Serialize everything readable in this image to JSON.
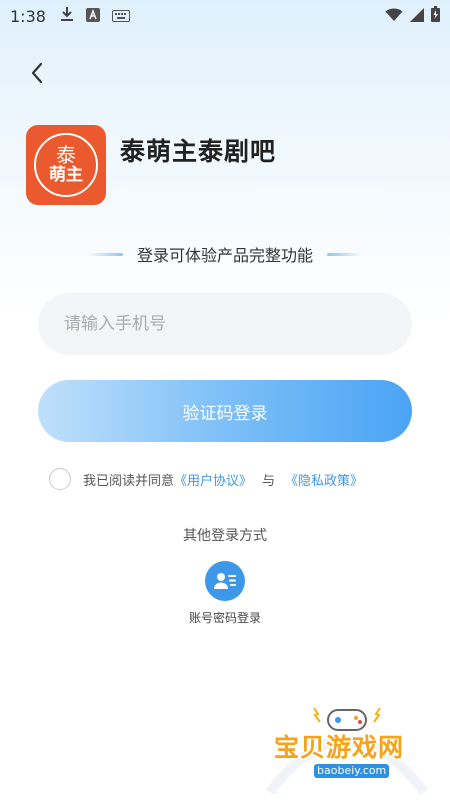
{
  "status_bar": {
    "time": "1:38",
    "left_icons": [
      "download-icon",
      "a-app-icon",
      "keyboard-icon"
    ],
    "right_icons": [
      "wifi-icon",
      "signal-icon",
      "battery-icon"
    ]
  },
  "nav": {
    "back_icon": "chevron-left-icon"
  },
  "app": {
    "logo_line1": "泰",
    "logo_line2": "萌主",
    "name": "泰萌主泰剧吧",
    "logo_color": "#ea5a2e"
  },
  "subtitle": "登录可体验产品完整功能",
  "phone_input": {
    "placeholder": "请输入手机号",
    "value": ""
  },
  "login_button": {
    "label": "验证码登录",
    "accent": "#4aa4f4"
  },
  "agreement": {
    "prefix": "我已阅读并同意",
    "user_agreement": "《用户协议》",
    "and": "与",
    "privacy_policy": "《隐私政策》",
    "link_color": "#3d98ea"
  },
  "other_login": {
    "title": "其他登录方式",
    "account_password_label": "账号密码登录",
    "icon": "user-card-icon"
  },
  "watermark": {
    "text": "宝贝游戏网",
    "url": "baobeiy.com"
  }
}
